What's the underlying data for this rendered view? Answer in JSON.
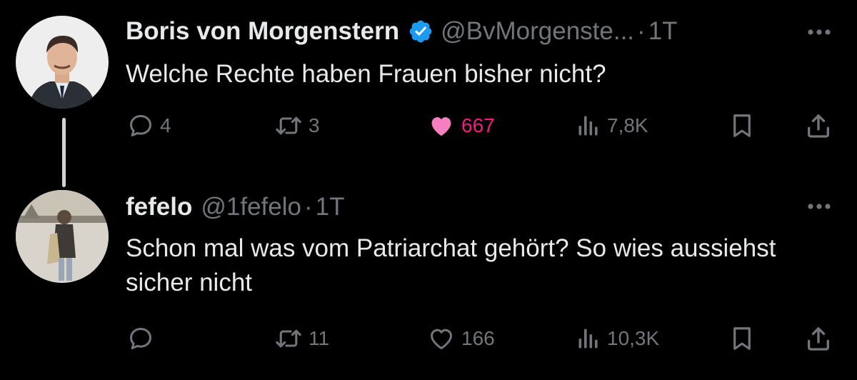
{
  "tweet": {
    "display_name": "Boris von Morgenstern",
    "handle": "@BvMorgenste...",
    "separator": "·",
    "time": "1T",
    "text": "Welche Rechte haben Frauen bisher nicht?",
    "verified": true,
    "stats": {
      "replies": "4",
      "retweets": "3",
      "likes": "667",
      "views": "7,8K"
    },
    "liked": true
  },
  "reply": {
    "display_name": "fefelo",
    "handle": "@1fefelo",
    "separator": "·",
    "time": "1T",
    "text": "Schon mal was vom Patriarchat gehört? So wies aussiehst sicher nicht",
    "stats": {
      "retweets": "11",
      "likes": "166",
      "views": "10,3K"
    },
    "liked": false
  },
  "colors": {
    "background": "#000000",
    "text": "#e7e9ea",
    "muted": "#71767b",
    "like_pink": "#f91880",
    "verified_blue": "#1d9bf0"
  },
  "icons": {
    "reply": "reply-bubble-icon",
    "retweet": "retweet-icon",
    "like": "heart-icon",
    "views": "views-bar-chart-icon",
    "bookmark": "bookmark-icon",
    "share": "share-icon",
    "more": "more-dots-icon",
    "verified": "verified-badge-icon"
  }
}
